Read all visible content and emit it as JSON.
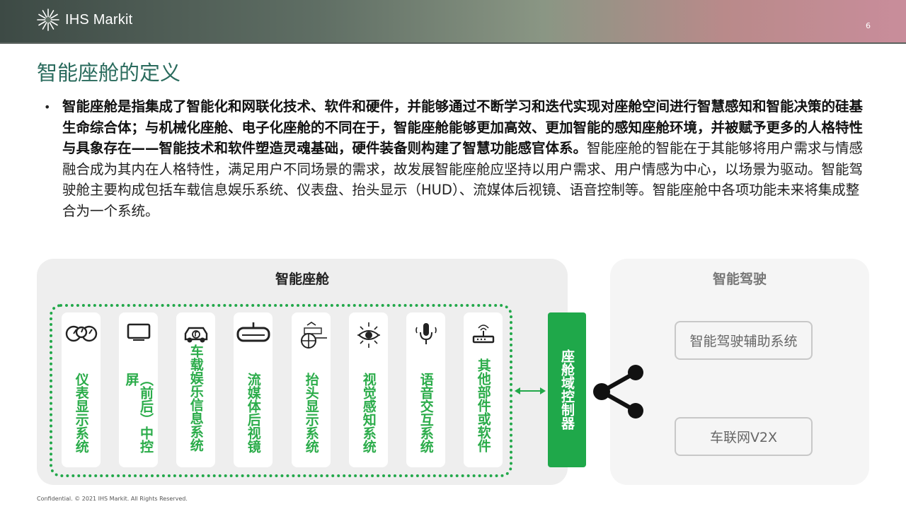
{
  "header": {
    "brand": "IHS Markit",
    "brand_mark": "™",
    "page_number": "6",
    "logo_icon": "starburst-logo-icon"
  },
  "slide": {
    "title": "智能座舱的定义",
    "bullet_symbol": "•",
    "paragraph_bold": "智能座舱是指集成了智能化和网联化技术、软件和硬件，并能够通过不断学习和迭代实现对座舱空间进行智慧感知和智能决策的硅基生命综合体；与机械化座舱、电子化座舱的不同在于，智能座舱能够更加高效、更加智能的感知座舱环境，并被赋予更多的人格特性与具象存在——智能技术和软件塑造灵魂基础，硬件装备则构建了智慧功能感官体系。",
    "paragraph_regular": "智能座舱的智能在于其能够将用户需求与情感融合成为其内在人格特性，满足用户不同场景的需求，故发展智能座舱应坚持以用户需求、用户情感为中心，以场景为驱动。智能驾驶舱主要构成包括车载信息娱乐系统、仪表盘、抬头显示（HUD）、流媒体后视镜、语音控制等。智能座舱中各项功能未来将集成整合为一个系统。"
  },
  "diagram": {
    "cockpit_title": "智能座舱",
    "driving_title": "智能驾驶",
    "cards": [
      {
        "label": "仪表显示系统",
        "icon": "gauge-cluster-icon"
      },
      {
        "label": "（前后）中控屏",
        "icon": "display-screen-icon"
      },
      {
        "label": "车载娱乐信息系统",
        "icon": "car-music-icon"
      },
      {
        "label": "流媒体后视镜",
        "icon": "rearview-mirror-icon"
      },
      {
        "label": "抬头显示系统",
        "icon": "head-up-display-icon"
      },
      {
        "label": "视觉感知系统",
        "icon": "vision-eye-icon"
      },
      {
        "label": "语音交互系统",
        "icon": "microphone-icon"
      },
      {
        "label": "其他部件或软件",
        "icon": "router-icon"
      }
    ],
    "controller_label": "座舱域控制器",
    "driving_boxes": [
      "智能驾驶辅助系统",
      "车联网V2X"
    ],
    "link_icon": "share-icon",
    "arrow_icon": "double-arrow-icon",
    "colors": {
      "accent_green": "#22a84a",
      "title_teal": "#2a6b5d",
      "panel_gray": "#eeeeee"
    }
  },
  "footer": {
    "text": "Confidential. © 2021 IHS Markit. All Rights Reserved."
  }
}
